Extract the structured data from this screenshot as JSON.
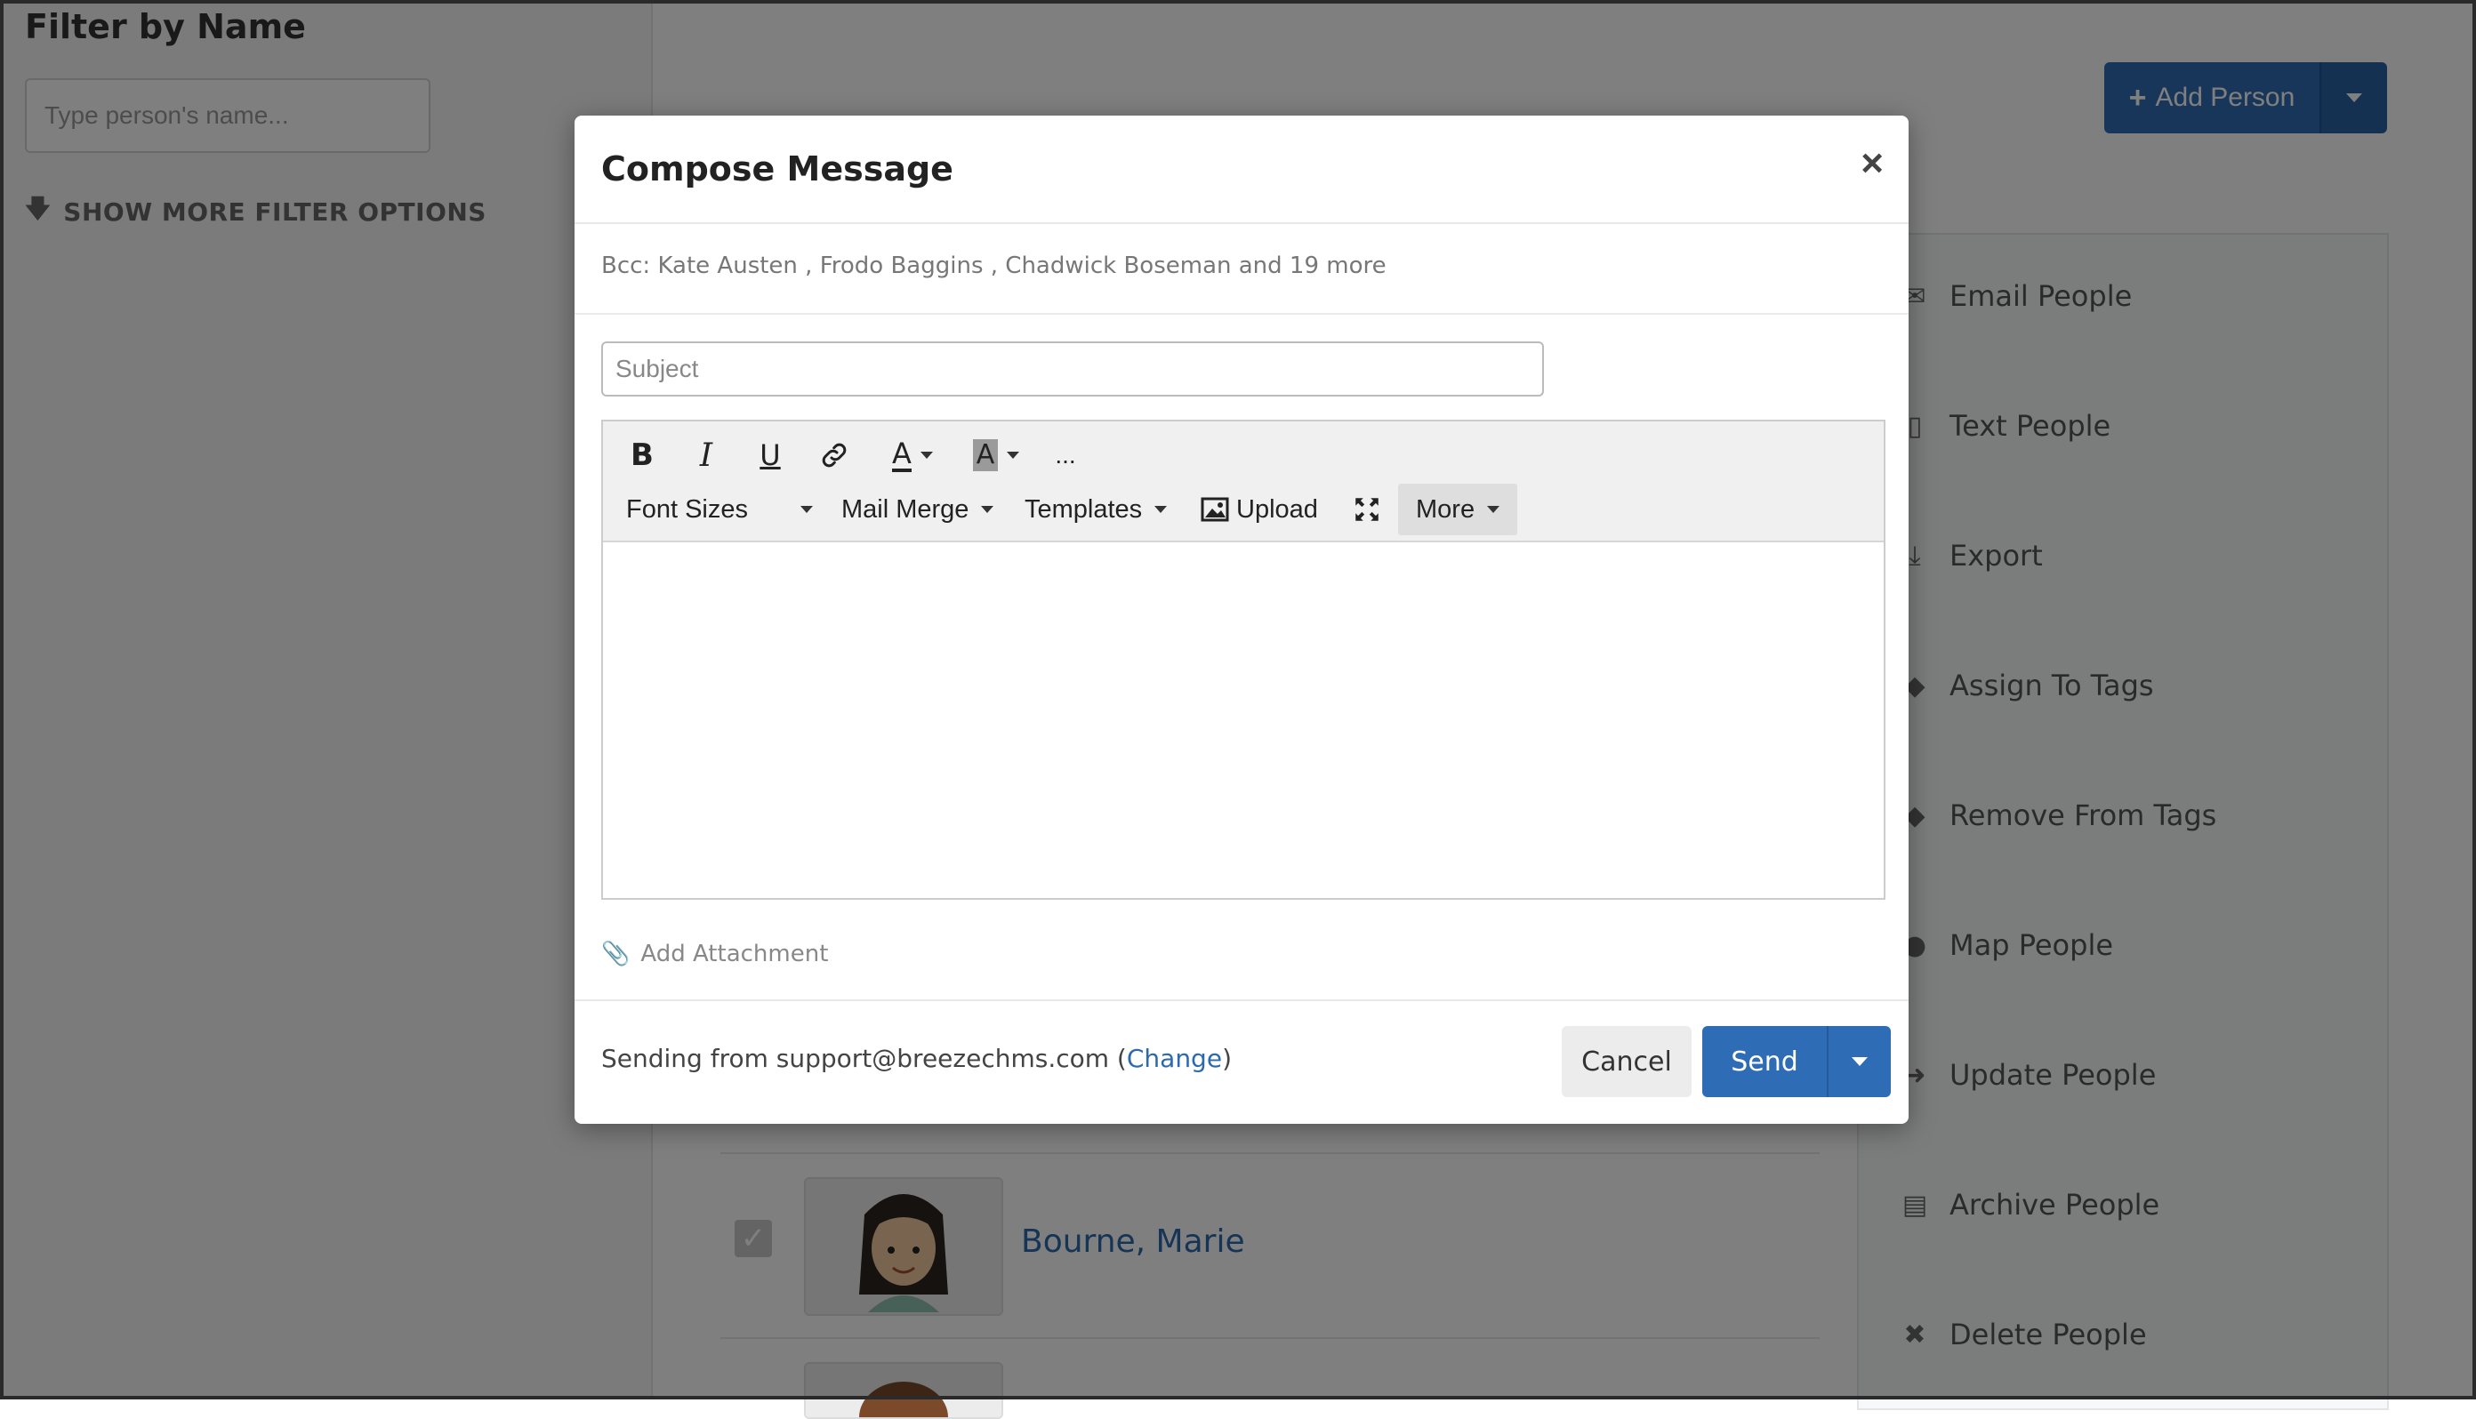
{
  "filter": {
    "title": "Filter by Name",
    "search_placeholder": "Type person's name...",
    "more_options": "SHOW MORE FILTER OPTIONS"
  },
  "header": {
    "add_person": "Add Person"
  },
  "actions": [
    {
      "label": "Email People",
      "icon": "envelope-icon"
    },
    {
      "label": "Text People",
      "icon": "phone-icon"
    },
    {
      "label": "Export",
      "icon": "download-icon"
    },
    {
      "label": "Assign To Tags",
      "icon": "tag-icon"
    },
    {
      "label": "Remove From Tags",
      "icon": "tag-icon"
    },
    {
      "label": "Map People",
      "icon": "map-marker-icon"
    },
    {
      "label": "Update People",
      "icon": "arrow-right-icon"
    },
    {
      "label": "Archive People",
      "icon": "archive-icon"
    },
    {
      "label": "Delete People",
      "icon": "close-icon"
    }
  ],
  "people": [
    {
      "name": "Bourne, Marie",
      "checked": true
    }
  ],
  "modal": {
    "title": "Compose Message",
    "close_label": "×",
    "bcc": "Bcc:  Kate Austen , Frodo Baggins , Chadwick Boseman and 19 more",
    "subject_placeholder": "Subject",
    "toolbar": {
      "bold": "B",
      "italic": "I",
      "underline": "U",
      "font_color": "A",
      "bg_color": "A",
      "overflow": "...",
      "font_sizes": "Font Sizes",
      "mail_merge": "Mail Merge",
      "templates": "Templates",
      "upload": "Upload",
      "more": "More"
    },
    "add_attachment": "Add Attachment",
    "sending_prefix": "Sending from support@breezechms.com (",
    "change_link": "Change",
    "sending_suffix": ")",
    "cancel": "Cancel",
    "send": "Send"
  }
}
